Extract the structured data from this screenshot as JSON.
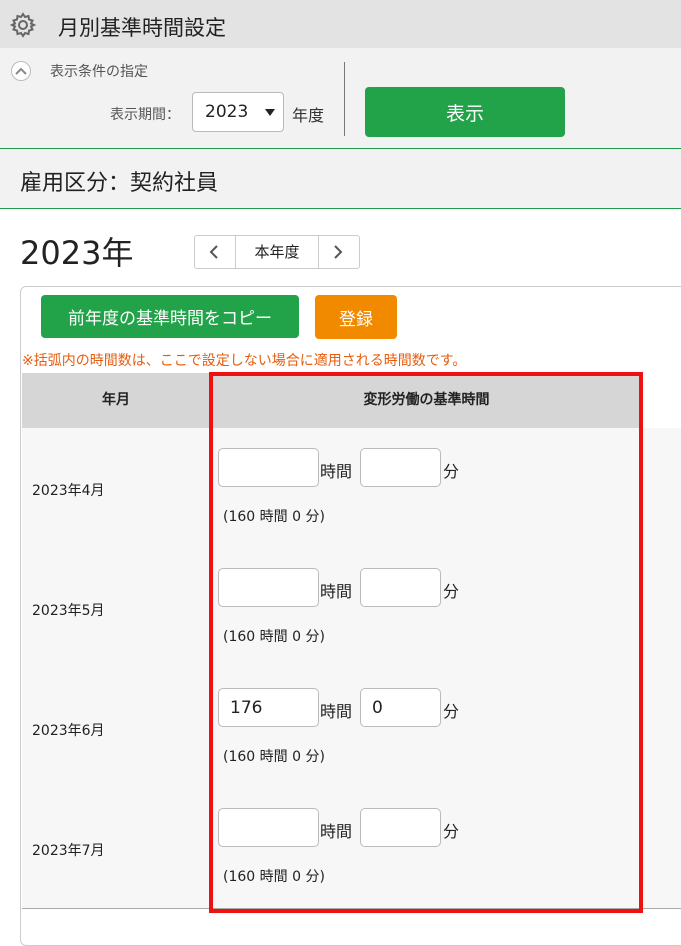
{
  "header": {
    "title": "月別基準時間設定",
    "icon": "gear-icon"
  },
  "filter": {
    "heading": "表示条件の指定",
    "period_label": "表示期間：",
    "year_value": "2023",
    "year_suffix": "年度",
    "show_button": "表示"
  },
  "employment": {
    "label": "雇用区分：契約社員"
  },
  "year_nav": {
    "heading": "2023年",
    "current_label": "本年度"
  },
  "actions": {
    "copy_button": "前年度の基準時間をコピー",
    "register_button": "登録"
  },
  "note": "※括弧内の時間数は、ここで設定しない場合に適用される時間数です。",
  "table": {
    "headers": {
      "month": "年月",
      "hours": "変形労働の基準時間"
    },
    "hour_unit": "時間",
    "minute_unit": "分",
    "rows": [
      {
        "month": "2023年4月",
        "hours": "",
        "minutes": "",
        "default": "(160 時間 0 分)"
      },
      {
        "month": "2023年5月",
        "hours": "",
        "minutes": "",
        "default": "(160 時間 0 分)"
      },
      {
        "month": "2023年6月",
        "hours": "176",
        "minutes": "0",
        "default": "(160 時間 0 分)"
      },
      {
        "month": "2023年7月",
        "hours": "",
        "minutes": "",
        "default": "(160 時間 0 分)"
      }
    ]
  },
  "colors": {
    "primary_green": "#22a34a",
    "register_orange": "#f28a00",
    "note_orange": "#e85c0d",
    "highlight_red": "#ee1111"
  }
}
